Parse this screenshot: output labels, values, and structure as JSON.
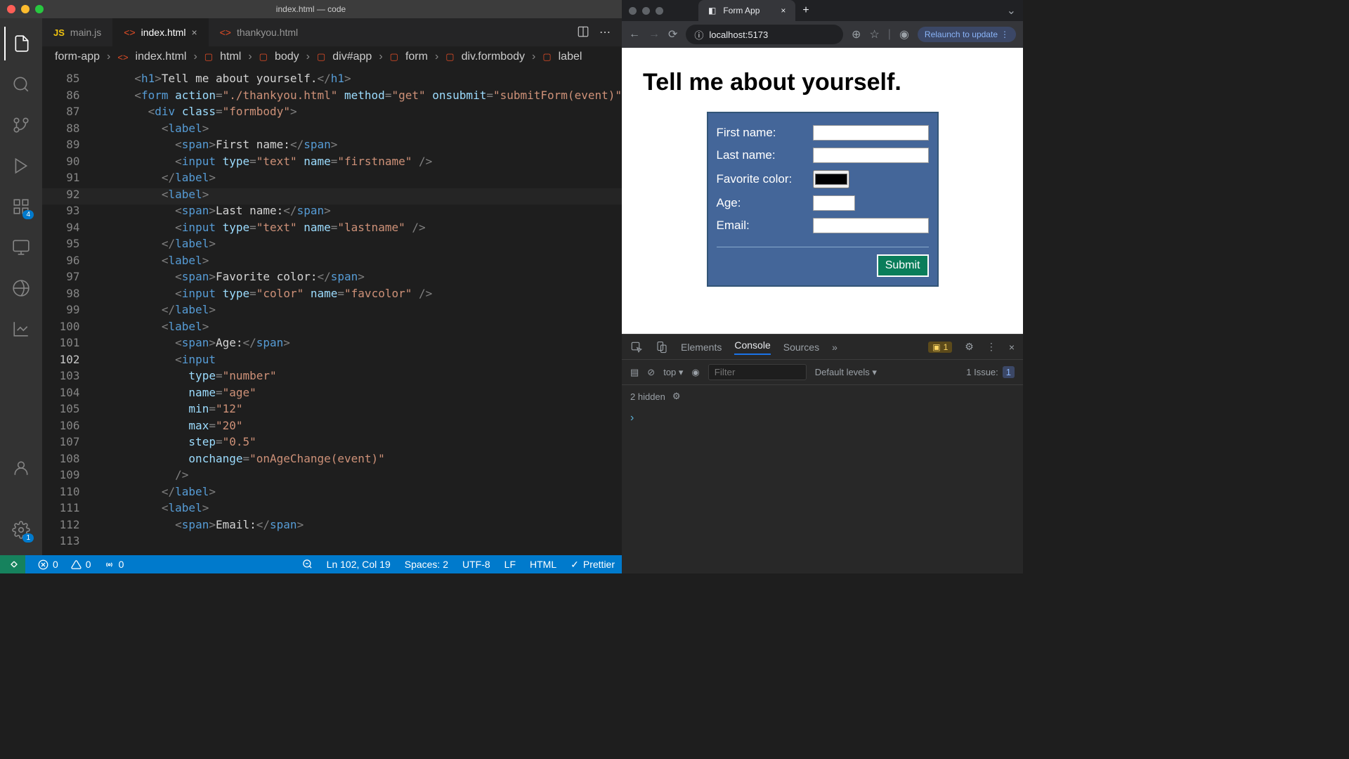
{
  "vscode": {
    "title": "index.html — code",
    "tabs": [
      {
        "icon": "JS",
        "label": "main.js",
        "active": false
      },
      {
        "icon": "<>",
        "label": "index.html",
        "active": true
      },
      {
        "icon": "<>",
        "label": "thankyou.html",
        "active": false
      }
    ],
    "breadcrumbs": [
      "form-app",
      "index.html",
      "html",
      "body",
      "div#app",
      "form",
      "div.formbody",
      "label"
    ],
    "activity_badge_ext": "4",
    "activity_badge_settings": "1",
    "line_numbers": {
      "start": 85,
      "end": 113,
      "active": 102
    },
    "code_lines": [
      {
        "indent": 3,
        "html": "<span class='pun'>&lt;</span><span class='tag'>h1</span><span class='pun'>&gt;</span><span class='txt'>Tell me about yourself.</span><span class='pun'>&lt;/</span><span class='tag'>h1</span><span class='pun'>&gt;</span>"
      },
      {
        "indent": 3,
        "html": "<span class='pun'>&lt;</span><span class='tag'>form</span> <span class='attr'>action</span><span class='pun'>=</span><span class='str'>\"./thankyou.html\"</span> <span class='attr'>method</span><span class='pun'>=</span><span class='str'>\"get\"</span> <span class='attr'>onsubmit</span><span class='pun'>=</span><span class='str'>\"submitForm(event)\"</span>"
      },
      {
        "indent": 4,
        "html": "<span class='pun'>&lt;</span><span class='tag'>div</span> <span class='attr'>class</span><span class='pun'>=</span><span class='str'>\"formbody\"</span><span class='pun'>&gt;</span>"
      },
      {
        "indent": 5,
        "html": "<span class='pun'>&lt;</span><span class='tag'>label</span><span class='pun'>&gt;</span>"
      },
      {
        "indent": 6,
        "html": "<span class='pun'>&lt;</span><span class='tag'>span</span><span class='pun'>&gt;</span><span class='txt'>First name:</span><span class='pun'>&lt;/</span><span class='tag'>span</span><span class='pun'>&gt;</span>"
      },
      {
        "indent": 6,
        "html": "<span class='pun'>&lt;</span><span class='tag'>input</span> <span class='attr'>type</span><span class='pun'>=</span><span class='str'>\"text\"</span> <span class='attr'>name</span><span class='pun'>=</span><span class='str'>\"firstname\"</span> <span class='pun'>/&gt;</span>"
      },
      {
        "indent": 5,
        "html": "<span class='pun'>&lt;/</span><span class='tag'>label</span><span class='pun'>&gt;</span>"
      },
      {
        "indent": 5,
        "html": "<span class='pun'>&lt;</span><span class='tag'>label</span><span class='pun'>&gt;</span>"
      },
      {
        "indent": 6,
        "html": "<span class='pun'>&lt;</span><span class='tag'>span</span><span class='pun'>&gt;</span><span class='txt'>Last name:</span><span class='pun'>&lt;/</span><span class='tag'>span</span><span class='pun'>&gt;</span>"
      },
      {
        "indent": 6,
        "html": "<span class='pun'>&lt;</span><span class='tag'>input</span> <span class='attr'>type</span><span class='pun'>=</span><span class='str'>\"text\"</span> <span class='attr'>name</span><span class='pun'>=</span><span class='str'>\"lastname\"</span> <span class='pun'>/&gt;</span>"
      },
      {
        "indent": 5,
        "html": "<span class='pun'>&lt;/</span><span class='tag'>label</span><span class='pun'>&gt;</span>"
      },
      {
        "indent": 5,
        "html": "<span class='pun'>&lt;</span><span class='tag'>label</span><span class='pun'>&gt;</span>"
      },
      {
        "indent": 6,
        "html": "<span class='pun'>&lt;</span><span class='tag'>span</span><span class='pun'>&gt;</span><span class='txt'>Favorite color:</span><span class='pun'>&lt;/</span><span class='tag'>span</span><span class='pun'>&gt;</span>"
      },
      {
        "indent": 6,
        "html": "<span class='pun'>&lt;</span><span class='tag'>input</span> <span class='attr'>type</span><span class='pun'>=</span><span class='str'>\"color\"</span> <span class='attr'>name</span><span class='pun'>=</span><span class='str'>\"favcolor\"</span> <span class='pun'>/&gt;</span>"
      },
      {
        "indent": 5,
        "html": "<span class='pun'>&lt;/</span><span class='tag'>label</span><span class='pun'>&gt;</span>"
      },
      {
        "indent": 5,
        "html": "<span class='pun'>&lt;</span><span class='tag'>label</span><span class='pun'>&gt;</span>"
      },
      {
        "indent": 6,
        "html": "<span class='pun'>&lt;</span><span class='tag'>span</span><span class='pun'>&gt;</span><span class='txt'>Age:</span><span class='pun'>&lt;/</span><span class='tag'>span</span><span class='pun'>&gt;</span>"
      },
      {
        "indent": 6,
        "html": "<span class='pun'>&lt;</span><span class='tag'>input</span>"
      },
      {
        "indent": 7,
        "html": "<span class='attr'>type</span><span class='pun'>=</span><span class='str'>\"number\"</span>"
      },
      {
        "indent": 7,
        "html": "<span class='attr'>name</span><span class='pun'>=</span><span class='str'>\"age\"</span>"
      },
      {
        "indent": 7,
        "html": "<span class='attr'>min</span><span class='pun'>=</span><span class='str'>\"12\"</span>"
      },
      {
        "indent": 7,
        "html": "<span class='attr'>max</span><span class='pun'>=</span><span class='str'>\"20\"</span>"
      },
      {
        "indent": 7,
        "html": "<span class='attr'>step</span><span class='pun'>=</span><span class='str'>\"0.5\"</span>"
      },
      {
        "indent": 7,
        "html": "<span class='attr'>onchange</span><span class='pun'>=</span><span class='str'>\"onAgeChange(event)\"</span>"
      },
      {
        "indent": 6,
        "html": "<span class='pun'>/&gt;</span>"
      },
      {
        "indent": 5,
        "html": "<span class='pun'>&lt;/</span><span class='tag'>label</span><span class='pun'>&gt;</span>"
      },
      {
        "indent": 0,
        "html": ""
      },
      {
        "indent": 5,
        "html": "<span class='pun'>&lt;</span><span class='tag'>label</span><span class='pun'>&gt;</span>"
      },
      {
        "indent": 6,
        "html": "<span class='pun'>&lt;</span><span class='tag'>span</span><span class='pun'>&gt;</span><span class='txt'>Email:</span><span class='pun'>&lt;/</span><span class='tag'>span</span><span class='pun'>&gt;</span>"
      }
    ],
    "statusbar": {
      "errors": "0",
      "warnings": "0",
      "ports": "0",
      "cursor": "Ln 102, Col 19",
      "spaces": "Spaces: 2",
      "encoding": "UTF-8",
      "eol": "LF",
      "lang": "HTML",
      "prettier": "Prettier"
    }
  },
  "chrome": {
    "tab_title": "Form App",
    "url": "localhost:5173",
    "relaunch": "Relaunch to update"
  },
  "page": {
    "heading": "Tell me about yourself.",
    "labels": {
      "firstname": "First name:",
      "lastname": "Last name:",
      "favcolor": "Favorite color:",
      "age": "Age:",
      "email": "Email:"
    },
    "submit": "Submit"
  },
  "devtools": {
    "tabs": [
      "Elements",
      "Console",
      "Sources"
    ],
    "active_tab": "Console",
    "warn_count": "1",
    "context": "top",
    "filter_placeholder": "Filter",
    "levels": "Default levels",
    "issue_label": "1 Issue:",
    "issue_count": "1",
    "hidden": "2 hidden"
  }
}
